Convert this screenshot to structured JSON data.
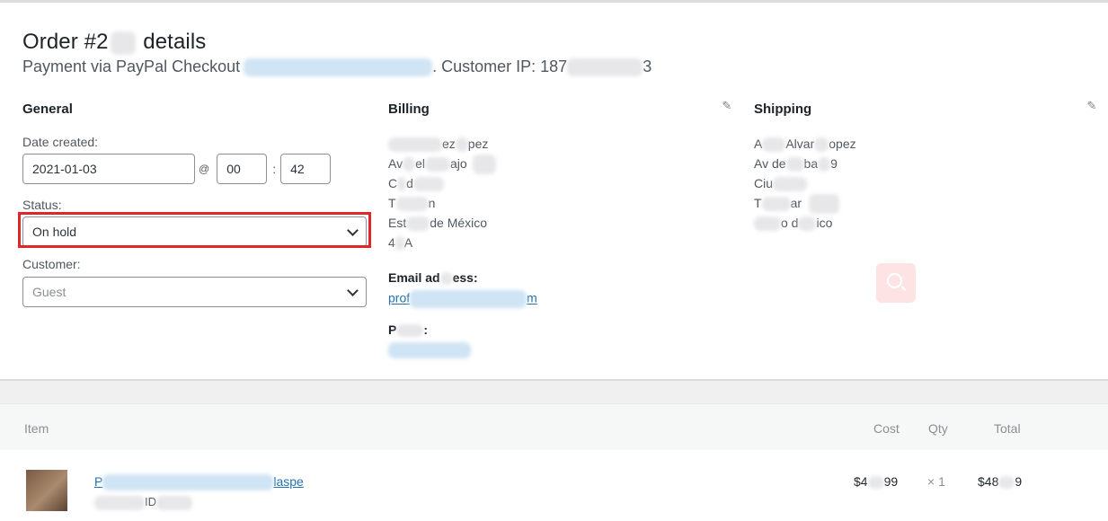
{
  "order": {
    "title_prefix": "Order #2",
    "title_suffix": " details",
    "payment_prefix": "Payment via PayPal Checkout",
    "customer_ip_prefix": ". Customer IP: 187",
    "customer_ip_suffix": "3"
  },
  "general": {
    "heading": "General",
    "date_label": "Date created:",
    "date_value": "2021-01-03",
    "at_symbol": "@",
    "hour_value": "00",
    "colon": ":",
    "minute_value": "42",
    "status_label": "Status:",
    "status_value": "On hold",
    "customer_label": "Customer:",
    "customer_value": "Guest"
  },
  "billing": {
    "heading": "Billing",
    "edit_icon": "pencil-icon",
    "lines": [
      "ez",
      "pez",
      "Av",
      "el",
      "ajo",
      "C",
      "d",
      "T",
      "n",
      "Est",
      "de México",
      "4",
      "A"
    ],
    "email_label_a": "Email ad",
    "email_label_b": "ess:",
    "email_value_a": "prof",
    "email_value_b": "m",
    "phone_label": "P",
    "phone_colon": ":"
  },
  "shipping": {
    "heading": "Shipping",
    "edit_icon": "pencil-icon",
    "l1a": "A",
    "l1b": "Alvar",
    "l1c": "opez",
    "l2a": "Av de",
    "l2b": "ba",
    "l2c": "9",
    "l3a": "Ciu",
    "l4a": "T",
    "l4b": "ar",
    "l5a": "o d",
    "l5b": "ico"
  },
  "items": {
    "headers": {
      "item": "Item",
      "cost": "Cost",
      "qty": "Qty",
      "total": "Total"
    },
    "rows": [
      {
        "name_a": "P",
        "name_b": "laspe",
        "id_label": "ID",
        "cost_a": "$4",
        "cost_b": "99",
        "qty": "× 1",
        "total_a": "$48",
        "total_b": "9"
      }
    ]
  }
}
